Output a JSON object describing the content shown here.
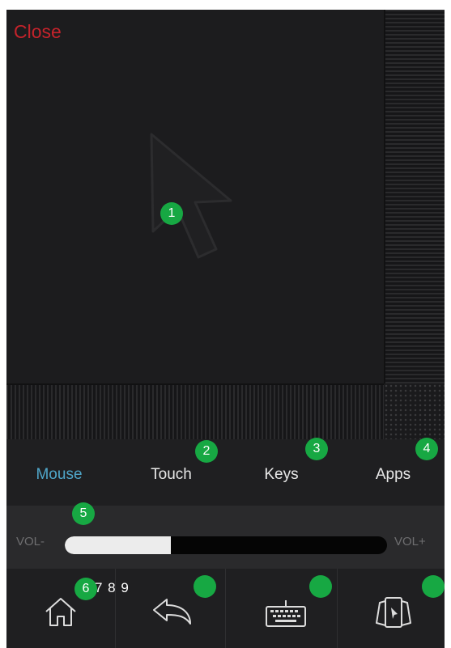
{
  "close_label": "Close",
  "tabs": [
    {
      "label": "Mouse",
      "active": true
    },
    {
      "label": "Touch",
      "active": false
    },
    {
      "label": "Keys",
      "active": false
    },
    {
      "label": "Apps",
      "active": false
    }
  ],
  "volume": {
    "minus_label": "VOL-",
    "plus_label": "VOL+",
    "level": 0.33
  },
  "bottom_nav": [
    {
      "icon": "home-icon"
    },
    {
      "icon": "back-arrow-icon"
    },
    {
      "icon": "keyboard-icon"
    },
    {
      "icon": "app-cards-icon"
    }
  ],
  "badges": {
    "b1": "1",
    "b2": "2",
    "b3": "3",
    "b4": "4",
    "b5": "5",
    "b6": "6",
    "b6_extra": "7 8 9"
  },
  "colors": {
    "accent": "#4fa6c9",
    "close": "#c4232b",
    "badge": "#17a843",
    "background": "#1b1b1d"
  }
}
